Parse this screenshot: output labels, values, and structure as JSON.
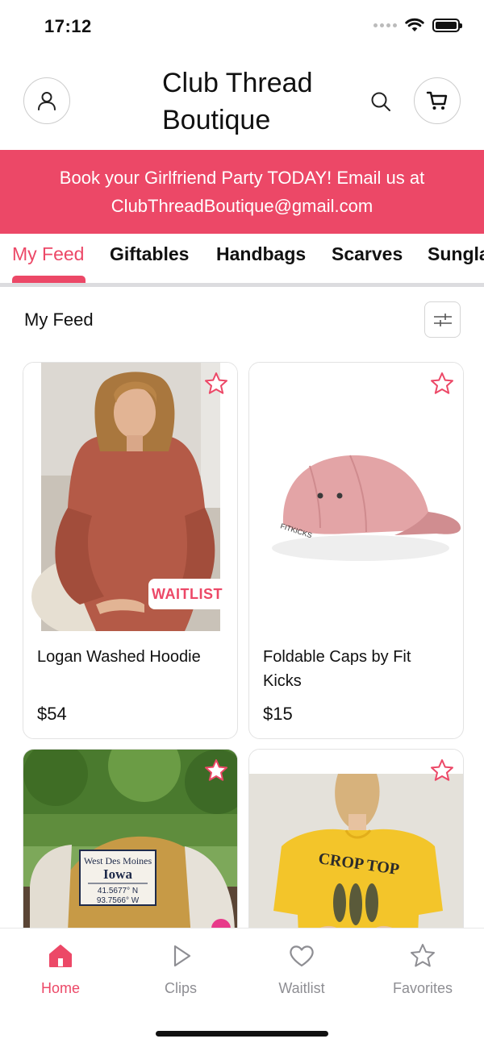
{
  "status_bar": {
    "time": "17:12"
  },
  "header": {
    "store_name": "Club Thread Boutique"
  },
  "banner": {
    "text": "Book your Girlfriend Party TODAY! Email us at ClubThreadBoutique@gmail.com"
  },
  "tabs": [
    {
      "label": "My Feed",
      "active": true
    },
    {
      "label": "Giftables"
    },
    {
      "label": "Handbags"
    },
    {
      "label": "Scarves"
    },
    {
      "label": "Sunglasses"
    }
  ],
  "feed": {
    "title": "My Feed"
  },
  "products": [
    {
      "name": "Logan Washed Hoodie",
      "price": "$54",
      "badge": "WAITLIST"
    },
    {
      "name": "Foldable Caps by Fit Kicks",
      "price": "$15",
      "image_text": "FITKICKS"
    },
    {
      "name": "",
      "price": "",
      "image_text": {
        "line1": "West Des Moines",
        "line2": "Iowa",
        "line3": "41.5677° N",
        "line4": "93.7566° W"
      }
    },
    {
      "name": "",
      "price": "",
      "image_text": "CROP TOP"
    }
  ],
  "bottom_nav": [
    {
      "label": "Home",
      "icon": "home-icon",
      "active": true
    },
    {
      "label": "Clips",
      "icon": "play-icon"
    },
    {
      "label": "Waitlist",
      "icon": "heart-icon"
    },
    {
      "label": "Favorites",
      "icon": "star-icon"
    }
  ],
  "colors": {
    "accent": "#ec4867",
    "inactive": "#8e8e93",
    "border": "#e2e2e2"
  }
}
